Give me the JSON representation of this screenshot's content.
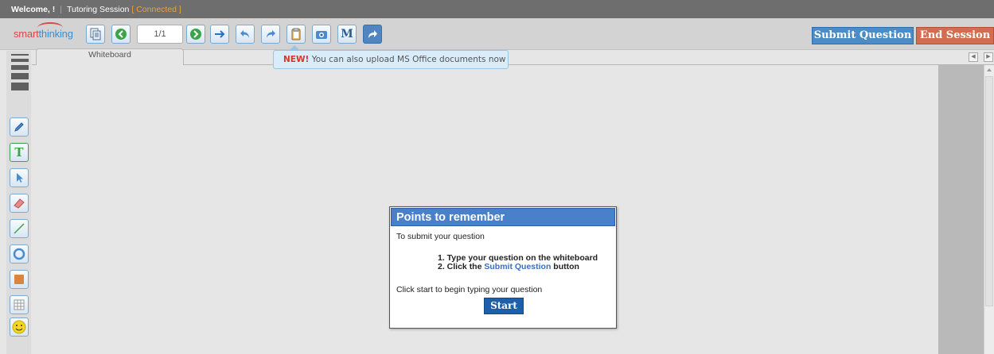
{
  "topbar": {
    "welcome": "Welcome, !",
    "separator": "|",
    "session_label": "Tutoring Session",
    "status": "[ Connected ]"
  },
  "logo": {
    "part1": "smart",
    "part2": "thinking"
  },
  "toolbar": {
    "page_indicator": "1/1",
    "submit_question": "Submit Question",
    "end_session": "End Session",
    "math_button": "M",
    "icons": [
      "documents-icon",
      "back-circle-icon",
      "forward-circle-icon",
      "arrow-right-icon",
      "undo-icon",
      "redo-icon",
      "clipboard-icon",
      "camera-icon",
      "math-icon",
      "share-icon"
    ]
  },
  "tab": {
    "label": "Whiteboard"
  },
  "tooltip": {
    "new": "NEW!",
    "text": "You can also upload MS Office documents now"
  },
  "sidebar": {
    "text_tool_label": "T",
    "tools": [
      "pencil-icon",
      "text-icon",
      "pointer-icon",
      "eraser-icon",
      "line-icon",
      "circle-icon",
      "rectangle-icon",
      "table-icon",
      "smiley-icon"
    ]
  },
  "dialog": {
    "title": "Points to remember",
    "intro": "To submit your question",
    "step1": "1. Type your question on the whiteboard",
    "step2_prefix": "2. Click the",
    "step2_link": "Submit Question",
    "step2_suffix": "button",
    "cta": "Click start to begin typing your question",
    "start": "Start"
  },
  "colors": {
    "submit_blue": "#4b8bc6",
    "end_orange": "#d26d50",
    "dialog_header": "#4a7fc9",
    "status_orange": "#e8a23c"
  }
}
